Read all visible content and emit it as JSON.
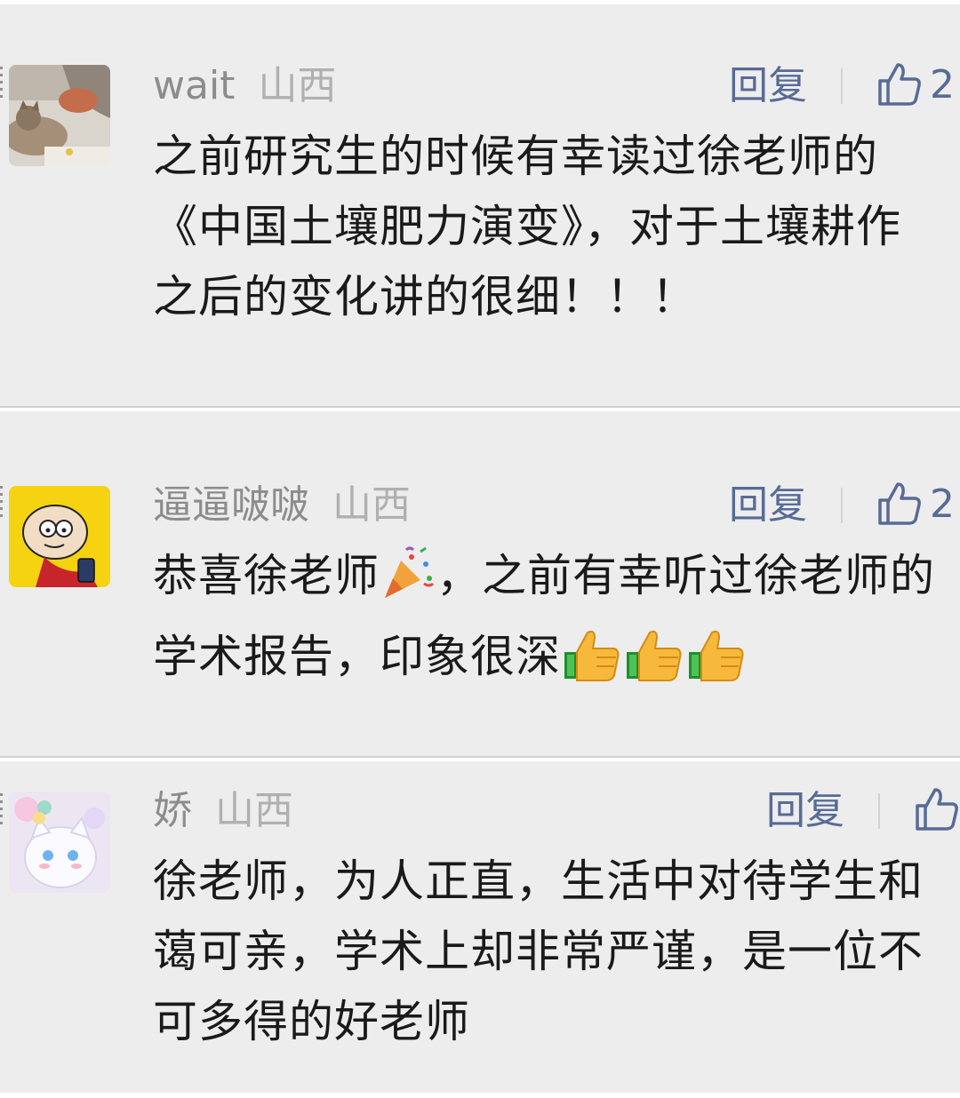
{
  "reply_label": "回复",
  "comments": [
    {
      "username": "wait",
      "location": "山西",
      "likes": "2",
      "text": "之前研究生的时候有幸读过徐老师的《中国土壤肥力演变》，对于土壤耕作之后的变化讲的很细！！！"
    },
    {
      "username": "逼逼啵啵",
      "location": "山西",
      "likes": "2",
      "text_part1": "恭喜徐老师",
      "text_part2": "，之前有幸听过徐老师的学术报告，印象很深"
    },
    {
      "username": "娇",
      "location": "山西",
      "likes": "",
      "text": "徐老师，为人正直，生活中对待学生和蔼可亲，学术上却非常严谨，是一位不可多得的好老师"
    }
  ],
  "icons": {
    "like": "thumbs-up-outline-icon",
    "party": "party-popper-emoji",
    "thumbs": "thumbs-up-emoji"
  },
  "colors": {
    "link": "#576b95",
    "meta": "#8c8c8c",
    "card": "#ededed"
  }
}
